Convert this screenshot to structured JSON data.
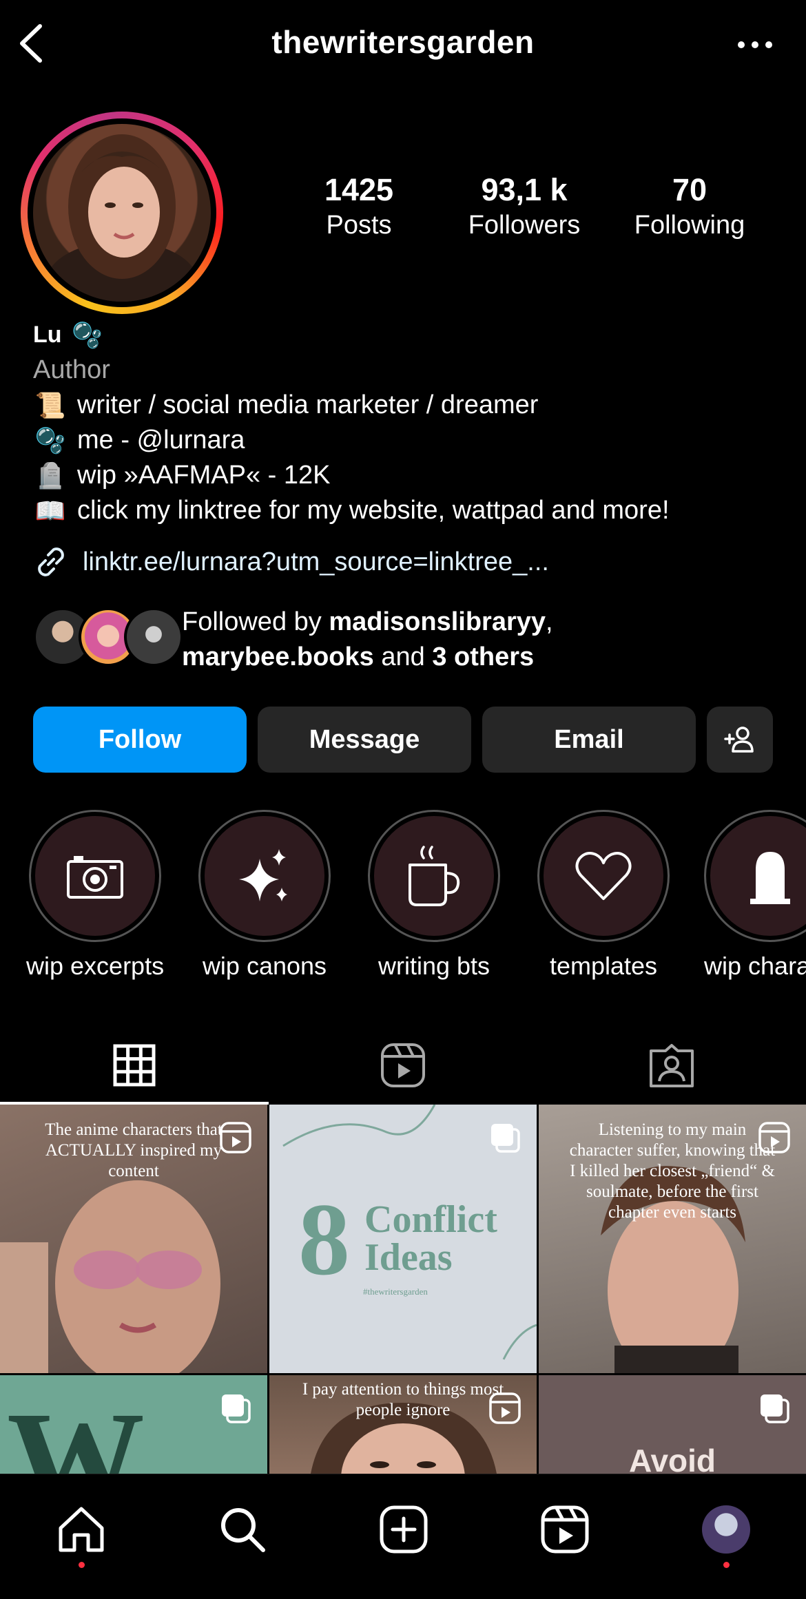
{
  "header": {
    "username": "thewritersgarden"
  },
  "profile": {
    "stats": {
      "posts": {
        "value": "1425",
        "label": "Posts"
      },
      "followers": {
        "value": "93,1 k",
        "label": "Followers"
      },
      "following": {
        "value": "70",
        "label": "Following"
      }
    },
    "name": "Lu",
    "name_emoji": "🫧",
    "category": "Author",
    "bio_lines": [
      {
        "emoji": "📜",
        "text": "writer / social media marketer / dreamer"
      },
      {
        "emoji": "🫧",
        "text": "me - @lurnara"
      },
      {
        "emoji": "🪦",
        "text": "wip »AAFMAP« - 12K"
      },
      {
        "emoji": "📖",
        "text": "click my linktree for my website, wattpad and more!"
      }
    ],
    "link": "linktr.ee/lurnara?utm_source=linktree_...",
    "followed_by": {
      "prefix": "Followed by ",
      "user1": "madisonslibraryy",
      "comma": ",",
      "user2": "marybee.books",
      "and": " and ",
      "others": "3 others"
    }
  },
  "actions": {
    "follow": "Follow",
    "message": "Message",
    "email": "Email"
  },
  "highlights": [
    {
      "label": "wip excerpts",
      "icon": "camera-icon"
    },
    {
      "label": "wip canons",
      "icon": "sparkles-icon"
    },
    {
      "label": "writing bts",
      "icon": "coffee-mug-icon"
    },
    {
      "label": "templates",
      "icon": "heart-icon"
    },
    {
      "label": "wip chara",
      "icon": "tombstone-icon"
    }
  ],
  "tabs": [
    {
      "name": "grid",
      "icon": "grid-icon",
      "active": true
    },
    {
      "name": "reels",
      "icon": "reels-icon",
      "active": false
    },
    {
      "name": "tagged",
      "icon": "tagged-icon",
      "active": false
    }
  ],
  "posts": [
    {
      "caption": "The anime characters that ACTUALLY inspired my content",
      "type": "reel"
    },
    {
      "caption_big": "8 Conflict Ideas",
      "caption_small": "#thewritersgarden",
      "type": "carousel"
    },
    {
      "caption": "Listening to my main character suffer, knowing that I killed her closest „friend“ & soulmate, before the first chapter even starts",
      "type": "reel"
    },
    {
      "caption": "W",
      "type": "carousel"
    },
    {
      "caption": "I pay attention to things most people ignore",
      "type": "reel"
    },
    {
      "caption": "Avoid",
      "type": "carousel"
    }
  ],
  "colors": {
    "background": "#000000",
    "follow_button": "#0095f6",
    "secondary_button": "#262626",
    "muted_text": "#a8a8a8",
    "notification_dot": "#ff3040",
    "highlight_fill": "#2e1a1e"
  },
  "bottom_nav": [
    "home-icon",
    "search-icon",
    "create-icon",
    "reels-icon",
    "profile-avatar"
  ]
}
